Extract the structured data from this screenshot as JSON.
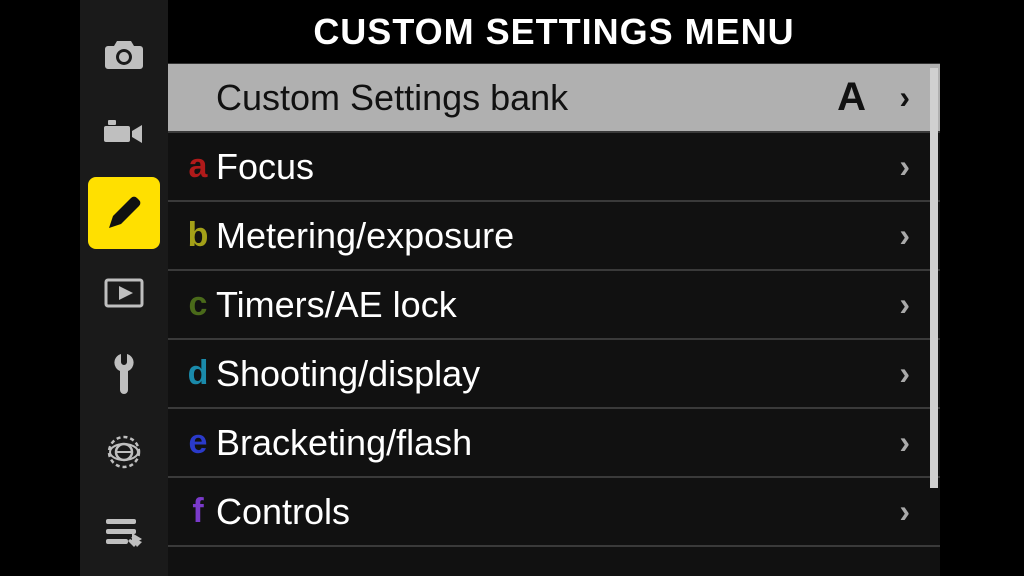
{
  "title": "CUSTOM SETTINGS MENU",
  "sidebar": {
    "active_index": 2
  },
  "rows": [
    {
      "prefix": "",
      "label": "Custom Settings bank",
      "value": "A",
      "selected": true
    },
    {
      "prefix": "a",
      "label": "Focus"
    },
    {
      "prefix": "b",
      "label": "Metering/exposure"
    },
    {
      "prefix": "c",
      "label": "Timers/AE lock"
    },
    {
      "prefix": "d",
      "label": "Shooting/display"
    },
    {
      "prefix": "e",
      "label": "Bracketing/flash"
    },
    {
      "prefix": "f",
      "label": "Controls"
    }
  ]
}
